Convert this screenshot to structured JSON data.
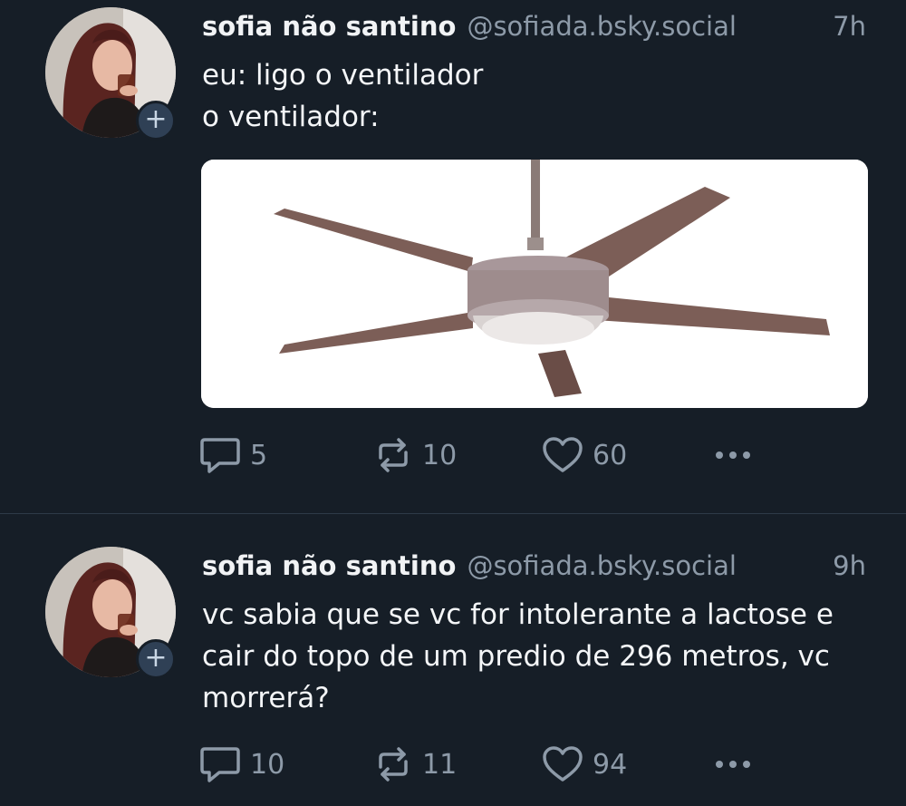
{
  "feed": {
    "posts": [
      {
        "author_name": "sofia não santino",
        "handle": "@sofiada.bsky.social",
        "time": "7h",
        "text_lines": [
          "eu: ligo o ventilador",
          "o ventilador:"
        ],
        "media": "ceiling-fan-image",
        "replies": "5",
        "reposts": "10",
        "likes": "60"
      },
      {
        "author_name": "sofia não santino",
        "handle": "@sofiada.bsky.social",
        "time": "9h",
        "text_lines": [
          "vc sabia que se vc for intolerante a lactose e",
          "cair do topo de um predio de 296 metros, vc",
          "morrerá?"
        ],
        "replies": "10",
        "reposts": "11",
        "likes": "94"
      }
    ]
  },
  "icons": {
    "reply": "speech-bubble-icon",
    "repost": "repost-arrows-icon",
    "like": "heart-icon",
    "more": "ellipsis-icon",
    "follow": "plus-icon"
  },
  "colors": {
    "background": "#161e27",
    "muted_text": "#8d9aa8",
    "divider": "#2e3a48",
    "badge": "#2f4055"
  },
  "follow_badge": "+"
}
